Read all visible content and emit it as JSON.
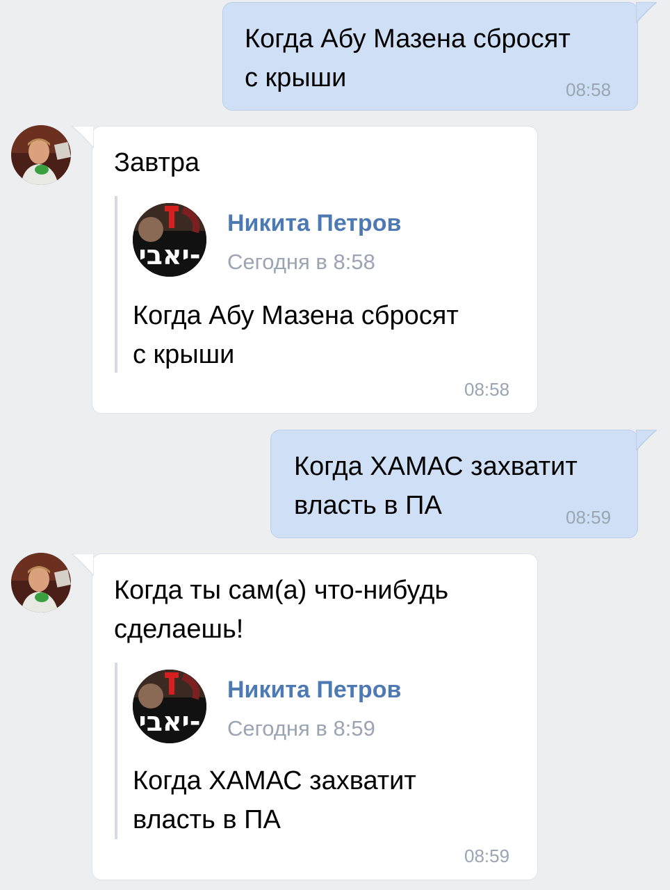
{
  "messages": [
    {
      "type": "outgoing",
      "text": "Когда Абу Мазена сбросят\nс крыши",
      "time": "08:58"
    },
    {
      "type": "incoming",
      "text": "Завтра",
      "time": "08:58",
      "forward": {
        "name": "Никита Петров",
        "date": "Сегодня в 8:58",
        "text": "Когда Абу Мазена сбросят\nс крыши"
      }
    },
    {
      "type": "outgoing",
      "text": "Когда ХАМАС захватит\nвласть в ПА",
      "time": "08:59"
    },
    {
      "type": "incoming",
      "text": "Когда ты сам(а) что-нибудь\nсделаешь!",
      "time": "08:59",
      "forward": {
        "name": "Никита Петров",
        "date": "Сегодня в 8:59",
        "text": "Когда ХАМАС захватит\nвласть в ПА"
      }
    }
  ],
  "colors": {
    "outgoing_bubble": "#cfe0f6",
    "incoming_bubble": "#ffffff",
    "background": "#edeef0",
    "author_name": "#4e7ab4",
    "timestamp": "#9aa4b2"
  }
}
